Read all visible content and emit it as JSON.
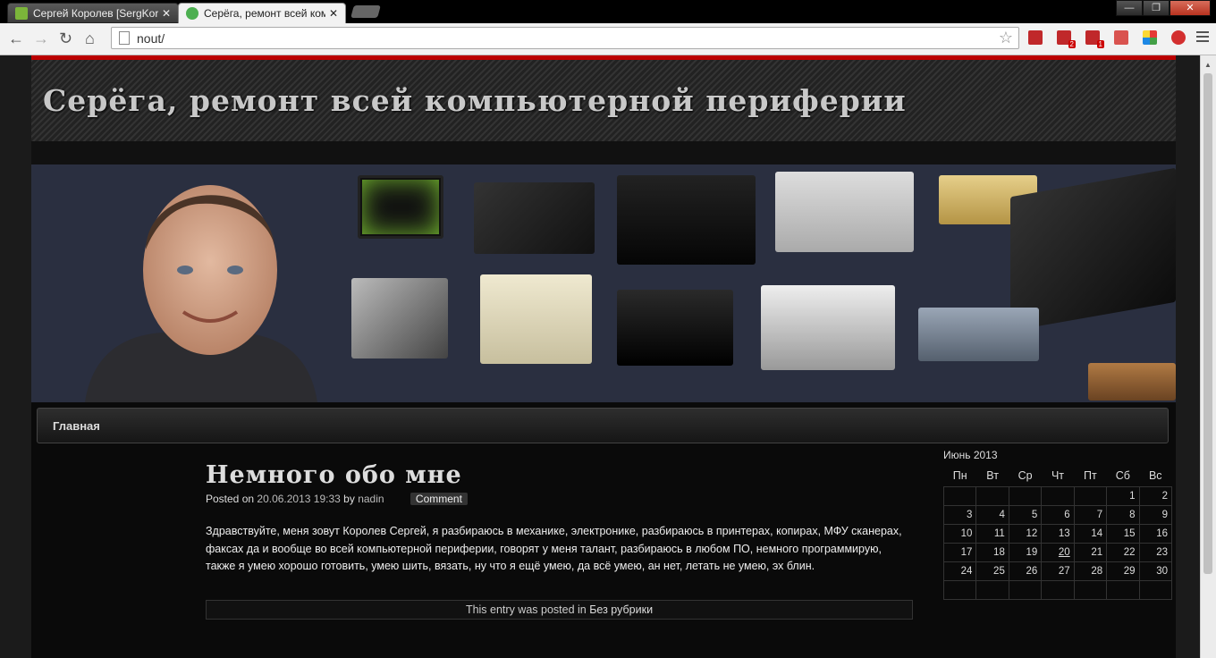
{
  "browser": {
    "tabs": [
      {
        "title": "Сергей Королев [SergKor",
        "favicon_color": "#7bb53a"
      },
      {
        "title": "Серёга, ремонт всей комп",
        "favicon_color": "#4caf50"
      }
    ],
    "url": "nout/",
    "window_buttons": {
      "minimize": "—",
      "maximize": "❐",
      "close": "✕"
    },
    "nav": {
      "back": "←",
      "forward": "→",
      "reload": "↻",
      "home": "⌂",
      "star": "☆"
    },
    "extensions": [
      {
        "name": "ext-red-doc",
        "color": "#c0282a",
        "badge": ""
      },
      {
        "name": "ext-chart-2",
        "color": "#c0282a",
        "badge": "2"
      },
      {
        "name": "ext-chart-1",
        "color": "#c0282a",
        "badge": "1"
      },
      {
        "name": "ext-card",
        "color": "#d9534f",
        "badge": ""
      },
      {
        "name": "ext-multicolor",
        "color": "#3b7ddd",
        "badge": ""
      },
      {
        "name": "ext-heart",
        "color": "#d32f2f",
        "badge": ""
      }
    ]
  },
  "site": {
    "title": "Серёга, ремонт всей компьютерной периферии",
    "accent": "#bb0000"
  },
  "nav": {
    "home": "Главная"
  },
  "post": {
    "title": "Немного обо мне",
    "posted_on": "Posted on",
    "date": "20.06.2013 19:33",
    "by": "by",
    "author": "nadin",
    "comment": "Comment",
    "body": "Здравствуйте, меня зовут Королев Сергей, я разбираюсь в механике, электронике, разбираюсь в принтерах, копирах, МФУ сканерах, факсах да и вообще во всей компьютерной периферии,  говорят у меня талант, разбираюсь в любом ПО, немного программирую, также я умею хорошо готовить, умею шить, вязать, ну что я ещё умею, да всё умею, ан нет, летать не умею, эх блин.",
    "footer_prefix": "This entry was posted in",
    "category": "Без рубрики"
  },
  "calendar": {
    "caption": "Июнь 2013",
    "days": [
      "Пн",
      "Вт",
      "Ср",
      "Чт",
      "Пт",
      "Сб",
      "Вс"
    ],
    "weeks": [
      [
        "",
        "",
        "",
        "",
        "",
        "1",
        "2"
      ],
      [
        "3",
        "4",
        "5",
        "6",
        "7",
        "8",
        "9"
      ],
      [
        "10",
        "11",
        "12",
        "13",
        "14",
        "15",
        "16"
      ],
      [
        "17",
        "18",
        "19",
        "20",
        "21",
        "22",
        "23"
      ],
      [
        "24",
        "25",
        "26",
        "27",
        "28",
        "29",
        "30"
      ]
    ],
    "linked_day": "20"
  }
}
